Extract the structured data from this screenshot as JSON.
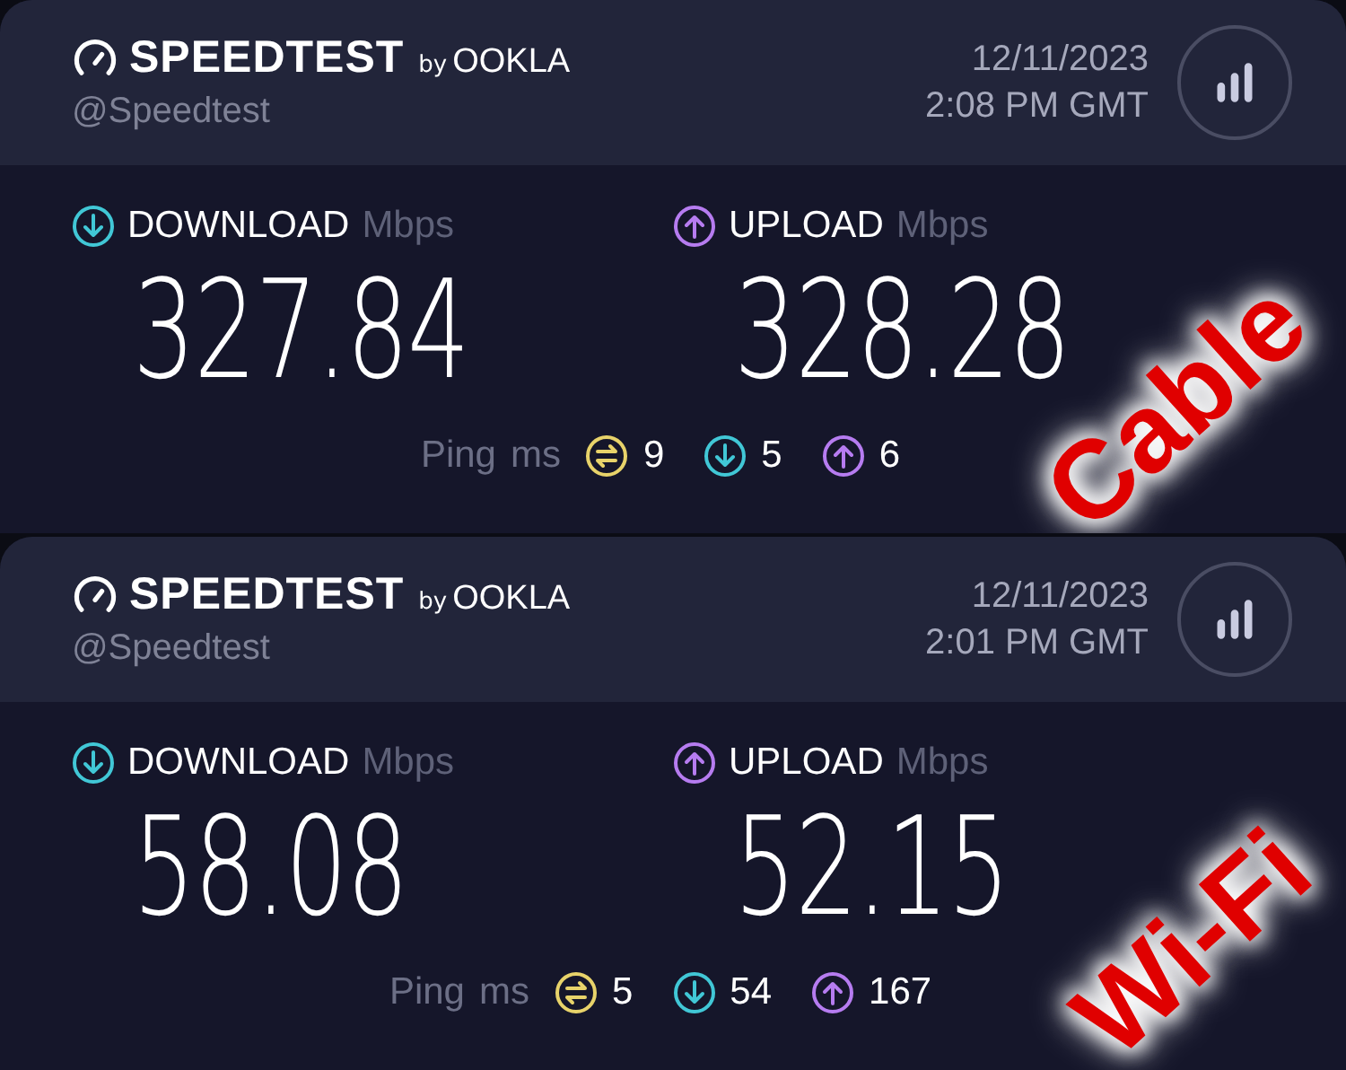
{
  "results": [
    {
      "brand": "SPEEDTEST",
      "brand_suffix": "by",
      "brand_company": "OOKLA",
      "handle": "@Speedtest",
      "date": "12/11/2023",
      "time": "2:08 PM GMT",
      "download": {
        "label": "DOWNLOAD",
        "unit": "Mbps",
        "value": "327.84"
      },
      "upload": {
        "label": "UPLOAD",
        "unit": "Mbps",
        "value": "328.28"
      },
      "ping": {
        "label": "Ping",
        "unit": "ms",
        "idle": "9",
        "down": "5",
        "up": "6"
      },
      "overlay_label": "Cable"
    },
    {
      "brand": "SPEEDTEST",
      "brand_suffix": "by",
      "brand_company": "OOKLA",
      "handle": "@Speedtest",
      "date": "12/11/2023",
      "time": "2:01 PM GMT",
      "download": {
        "label": "DOWNLOAD",
        "unit": "Mbps",
        "value": "58.08"
      },
      "upload": {
        "label": "UPLOAD",
        "unit": "Mbps",
        "value": "52.15"
      },
      "ping": {
        "label": "Ping",
        "unit": "ms",
        "idle": "5",
        "down": "54",
        "up": "167"
      },
      "overlay_label": "Wi-Fi"
    }
  ]
}
